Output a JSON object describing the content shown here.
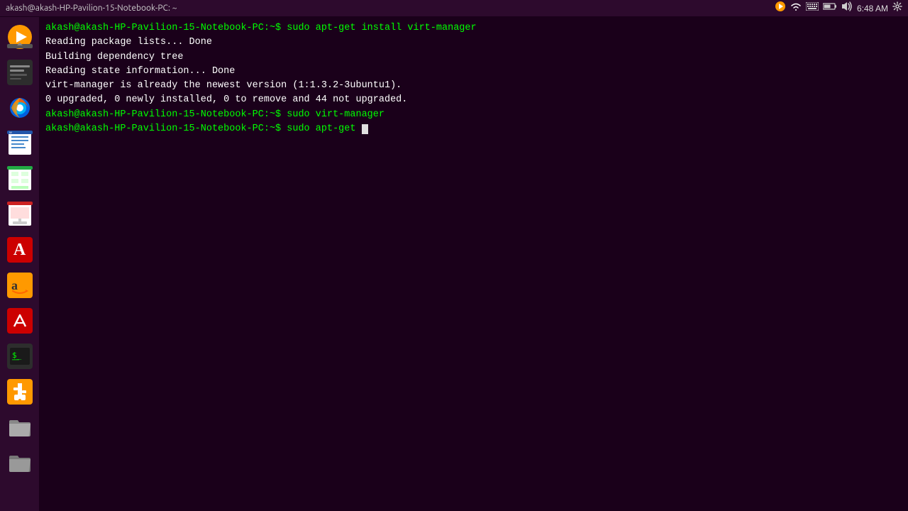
{
  "titlebar": {
    "title": "akash@akash-HP-Pavilion-15-Notebook-PC: ~",
    "minimize_label": "–",
    "maximize_label": "□",
    "close_label": "✕",
    "time": "6:48 AM",
    "tray": {
      "network_icon": "wifi",
      "keyboard_icon": "⌨",
      "battery_icon": "🔋",
      "volume_icon": "🔊",
      "settings_icon": "⚙"
    }
  },
  "terminal": {
    "lines": [
      {
        "type": "prompt",
        "text": "akash@akash-HP-Pavilion-15-Notebook-PC:~$ sudo apt-get install virt-manager"
      },
      {
        "type": "output",
        "text": "Reading package lists... Done"
      },
      {
        "type": "output",
        "text": "Building dependency tree"
      },
      {
        "type": "output",
        "text": "Reading state information... Done"
      },
      {
        "type": "output",
        "text": "virt-manager is already the newest version (1:1.3.2-3ubuntu1)."
      },
      {
        "type": "output",
        "text": "0 upgraded, 0 newly installed, 0 to remove and 44 not upgraded."
      },
      {
        "type": "prompt",
        "text": "akash@akash-HP-Pavilion-15-Notebook-PC:~$ sudo virt-manager"
      },
      {
        "type": "prompt_active",
        "text": "akash@akash-HP-Pavilion-15-Notebook-PC:~$ sudo apt-get "
      }
    ]
  },
  "sidebar": {
    "items": [
      {
        "id": "vlc",
        "label": "VLC media player"
      },
      {
        "id": "ubuntu",
        "label": "Ubuntu"
      },
      {
        "id": "firefox",
        "label": "Firefox"
      },
      {
        "id": "writer",
        "label": "LibreOffice Writer"
      },
      {
        "id": "calc",
        "label": "LibreOffice Calc"
      },
      {
        "id": "impress",
        "label": "LibreOffice Impress"
      },
      {
        "id": "font",
        "label": "Font Viewer"
      },
      {
        "id": "amazon",
        "label": "Amazon"
      },
      {
        "id": "scratch",
        "label": "Scratch"
      },
      {
        "id": "terminal",
        "label": "Terminal"
      },
      {
        "id": "usb",
        "label": "USB Creator"
      },
      {
        "id": "folder",
        "label": "Files"
      },
      {
        "id": "folder2",
        "label": "Files 2"
      }
    ]
  }
}
